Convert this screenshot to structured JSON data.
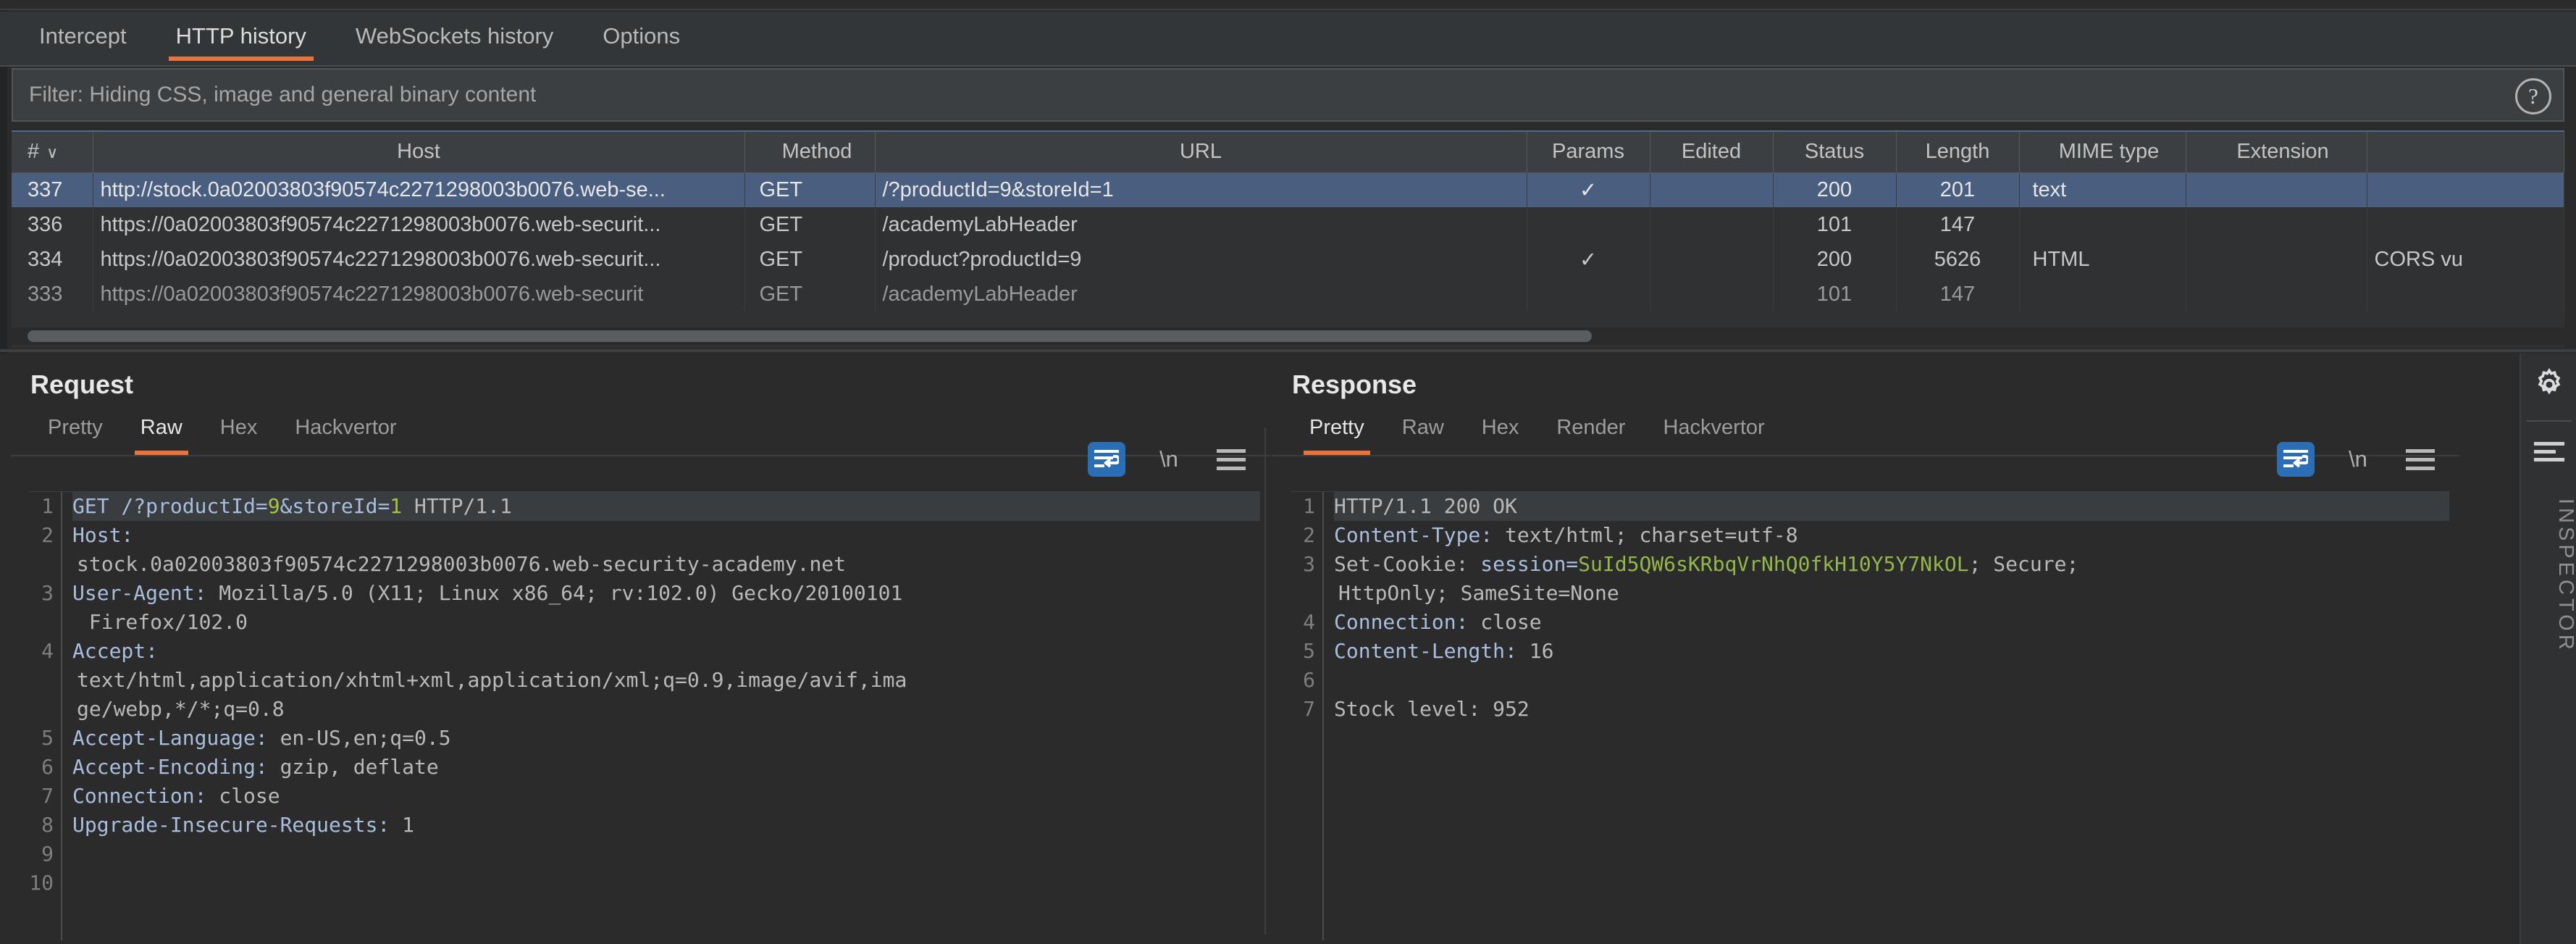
{
  "main_tabs": [
    {
      "label": "Intercept",
      "active": false
    },
    {
      "label": "HTTP history",
      "active": true
    },
    {
      "label": "WebSockets history",
      "active": false
    },
    {
      "label": "Options",
      "active": false
    }
  ],
  "filter": {
    "text": "Filter: Hiding CSS, image and general binary content",
    "help_icon": "question-mark-icon",
    "help_glyph": "?"
  },
  "history_table": {
    "columns": [
      {
        "key": "num",
        "label": "#",
        "sorted": true,
        "caret": "∨"
      },
      {
        "key": "host",
        "label": "Host"
      },
      {
        "key": "method",
        "label": "Method"
      },
      {
        "key": "url",
        "label": "URL"
      },
      {
        "key": "params",
        "label": "Params"
      },
      {
        "key": "edited",
        "label": "Edited"
      },
      {
        "key": "status",
        "label": "Status"
      },
      {
        "key": "length",
        "label": "Length"
      },
      {
        "key": "mime",
        "label": "MIME type"
      },
      {
        "key": "extension",
        "label": "Extension"
      },
      {
        "key": "rest",
        "label": ""
      }
    ],
    "rows": [
      {
        "num": "337",
        "host": "http://stock.0a02003803f90574c2271298003b0076.web-se...",
        "method": "GET",
        "url": "/?productId=9&storeId=1",
        "params": "✓",
        "edited": "",
        "status": "200",
        "length": "201",
        "mime": "text",
        "extension": "",
        "rest": "",
        "selected": true
      },
      {
        "num": "336",
        "host": "https://0a02003803f90574c2271298003b0076.web-securit...",
        "method": "GET",
        "url": "/academyLabHeader",
        "params": "",
        "edited": "",
        "status": "101",
        "length": "147",
        "mime": "",
        "extension": "",
        "rest": "",
        "selected": false
      },
      {
        "num": "334",
        "host": "https://0a02003803f90574c2271298003b0076.web-securit...",
        "method": "GET",
        "url": "/product?productId=9",
        "params": "✓",
        "edited": "",
        "status": "200",
        "length": "5626",
        "mime": "HTML",
        "extension": "",
        "rest": "CORS vu",
        "selected": false
      },
      {
        "num": "333",
        "host": "https://0a02003803f90574c2271298003b0076.web-securit",
        "method": "GET",
        "url": "/academyLabHeader",
        "params": "",
        "edited": "",
        "status": "101",
        "length": "147",
        "mime": "",
        "extension": "",
        "rest": "",
        "selected": false
      }
    ]
  },
  "request_panel": {
    "title": "Request",
    "tabs": [
      {
        "label": "Pretty",
        "active": false
      },
      {
        "label": "Raw",
        "active": true
      },
      {
        "label": "Hex",
        "active": false
      },
      {
        "label": "Hackvertor",
        "active": false
      }
    ],
    "tools": [
      {
        "name": "word-wrap-icon",
        "active": true
      },
      {
        "name": "newline-icon",
        "glyph": "\\n",
        "active": false
      },
      {
        "name": "menu-icon",
        "active": false
      }
    ],
    "gutter": [
      "1",
      "2",
      "",
      "3",
      "",
      "4",
      "",
      "",
      "5",
      "6",
      "7",
      "8",
      "9",
      "10"
    ],
    "lines": [
      {
        "kind": "first",
        "parts": [
          {
            "t": "GET /?productId=",
            "c": "hdr"
          },
          {
            "t": "9",
            "c": "num"
          },
          {
            "t": "&storeId=",
            "c": "hdr"
          },
          {
            "t": "1",
            "c": "num"
          },
          {
            "t": " HTTP/1.1",
            "c": "val"
          }
        ]
      },
      {
        "kind": "normal",
        "parts": [
          {
            "t": "Host:",
            "c": "hdr"
          }
        ]
      },
      {
        "kind": "cont",
        "parts": [
          {
            "t": "stock.0a02003803f90574c2271298003b0076.web-security-academy.net",
            "c": "val"
          }
        ]
      },
      {
        "kind": "normal",
        "parts": [
          {
            "t": "User-Agent:",
            "c": "hdr"
          },
          {
            "t": " Mozilla/5.0 (X11; Linux x86_64; rv:102.0) Gecko/20100101",
            "c": "val"
          }
        ]
      },
      {
        "kind": "cont",
        "parts": [
          {
            "t": " Firefox/102.0",
            "c": "val"
          }
        ]
      },
      {
        "kind": "normal",
        "parts": [
          {
            "t": "Accept:",
            "c": "hdr"
          }
        ]
      },
      {
        "kind": "cont",
        "parts": [
          {
            "t": "text/html,application/xhtml+xml,application/xml;q=0.9,image/avif,ima",
            "c": "val"
          }
        ]
      },
      {
        "kind": "cont",
        "parts": [
          {
            "t": "ge/webp,*/*;q=0.8",
            "c": "val"
          }
        ]
      },
      {
        "kind": "normal",
        "parts": [
          {
            "t": "Accept-Language:",
            "c": "hdr"
          },
          {
            "t": " en-US,en;q=0.5",
            "c": "val"
          }
        ]
      },
      {
        "kind": "normal",
        "parts": [
          {
            "t": "Accept-Encoding:",
            "c": "hdr"
          },
          {
            "t": " gzip, deflate",
            "c": "val"
          }
        ]
      },
      {
        "kind": "normal",
        "parts": [
          {
            "t": "Connection:",
            "c": "hdr"
          },
          {
            "t": " close",
            "c": "val"
          }
        ]
      },
      {
        "kind": "normal",
        "parts": [
          {
            "t": "Upgrade-Insecure-Requests:",
            "c": "hdr"
          },
          {
            "t": " 1",
            "c": "val"
          }
        ]
      },
      {
        "kind": "normal",
        "parts": [
          {
            "t": "",
            "c": "val"
          }
        ]
      },
      {
        "kind": "normal",
        "parts": [
          {
            "t": "",
            "c": "val"
          }
        ]
      }
    ]
  },
  "response_panel": {
    "title": "Response",
    "tabs": [
      {
        "label": "Pretty",
        "active": true
      },
      {
        "label": "Raw",
        "active": false
      },
      {
        "label": "Hex",
        "active": false
      },
      {
        "label": "Render",
        "active": false
      },
      {
        "label": "Hackvertor",
        "active": false
      }
    ],
    "tools": [
      {
        "name": "word-wrap-icon",
        "active": true
      },
      {
        "name": "newline-icon",
        "glyph": "\\n",
        "active": false
      },
      {
        "name": "menu-icon",
        "active": false
      }
    ],
    "gutter": [
      "1",
      "2",
      "3",
      "",
      "4",
      "5",
      "6",
      "7"
    ],
    "lines": [
      {
        "kind": "first",
        "parts": [
          {
            "t": "HTTP/1.1 200 OK",
            "c": "val"
          }
        ]
      },
      {
        "kind": "normal",
        "parts": [
          {
            "t": "Content-Type:",
            "c": "hdr"
          },
          {
            "t": " text/html; charset=utf-8",
            "c": "val"
          }
        ]
      },
      {
        "kind": "normal",
        "parts": [
          {
            "t": "Set-Cookie: ",
            "c": "val"
          },
          {
            "t": "session=",
            "c": "hdr"
          },
          {
            "t": "SuId5QW6sKRbqVrNhQ0fkH10Y5Y7NkOL",
            "c": "grn"
          },
          {
            "t": "; Secure;",
            "c": "val"
          }
        ]
      },
      {
        "kind": "cont",
        "parts": [
          {
            "t": "HttpOnly; SameSite=None",
            "c": "val"
          }
        ]
      },
      {
        "kind": "normal",
        "parts": [
          {
            "t": "Connection:",
            "c": "hdr"
          },
          {
            "t": " close",
            "c": "val"
          }
        ]
      },
      {
        "kind": "normal",
        "parts": [
          {
            "t": "Content-Length:",
            "c": "hdr"
          },
          {
            "t": " 16",
            "c": "val"
          }
        ]
      },
      {
        "kind": "normal",
        "parts": [
          {
            "t": "",
            "c": "val"
          }
        ]
      },
      {
        "kind": "normal",
        "parts": [
          {
            "t": "Stock level: 952",
            "c": "val"
          }
        ]
      }
    ]
  },
  "layout_buttons": [
    {
      "name": "layout-side-by-side-icon",
      "active": true
    },
    {
      "name": "layout-stacked-icon",
      "active": false
    },
    {
      "name": "layout-single-icon",
      "active": false
    }
  ],
  "inspector": {
    "label": "INSPECTOR",
    "gear_icon": "gear-icon",
    "collapse_icon": "collapse-panel-icon"
  },
  "colors": {
    "accent": "#e8743b",
    "selection": "#4a5e80",
    "toggle_active": "#2b6eb5",
    "string_green": "#93b74a",
    "header_blue": "#a9bede"
  }
}
